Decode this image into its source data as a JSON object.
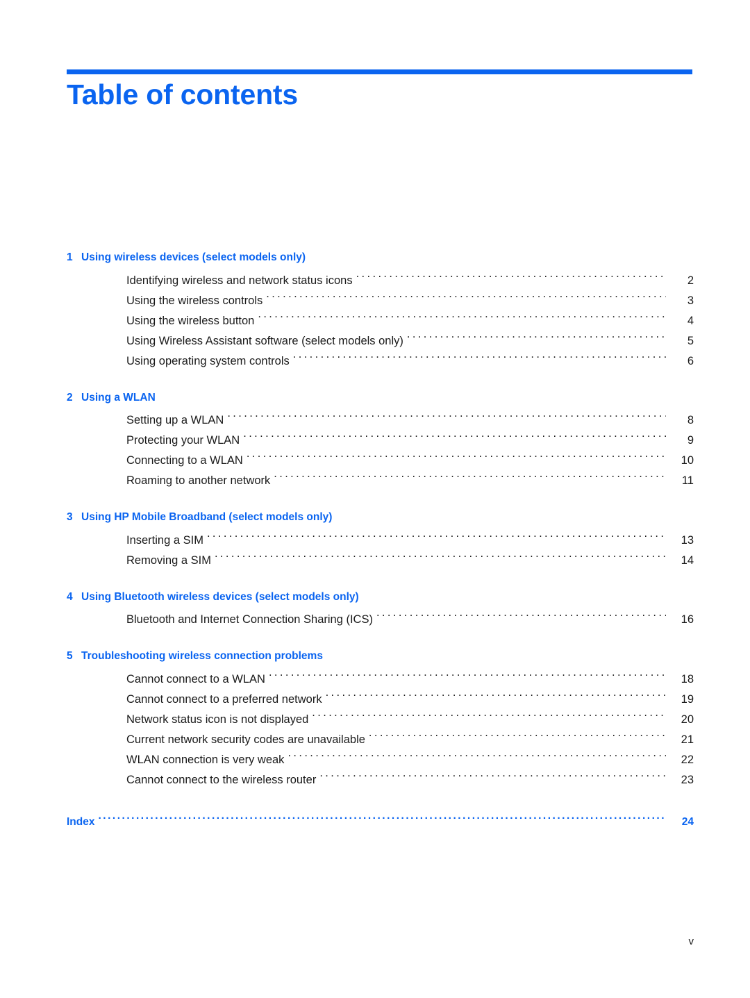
{
  "document": {
    "title": "Table of contents",
    "accent_color": "#0a64f0",
    "text_color": "#1a1a1a",
    "footer_page_number": "v"
  },
  "chapters": [
    {
      "number": "1",
      "title": "Using wireless devices (select models only)",
      "entries": [
        {
          "label": "Identifying wireless and network status icons",
          "page": "2"
        },
        {
          "label": "Using the wireless controls",
          "page": "3"
        },
        {
          "label": "Using the wireless button",
          "page": "4"
        },
        {
          "label": "Using Wireless Assistant software (select models only)",
          "page": "5"
        },
        {
          "label": "Using operating system controls",
          "page": "6"
        }
      ]
    },
    {
      "number": "2",
      "title": "Using a WLAN",
      "entries": [
        {
          "label": "Setting up a WLAN",
          "page": "8"
        },
        {
          "label": "Protecting your WLAN",
          "page": "9"
        },
        {
          "label": "Connecting to a WLAN",
          "page": "10"
        },
        {
          "label": "Roaming to another network",
          "page": "11"
        }
      ]
    },
    {
      "number": "3",
      "title": "Using HP Mobile Broadband (select models only)",
      "entries": [
        {
          "label": "Inserting a SIM",
          "page": "13"
        },
        {
          "label": "Removing a SIM",
          "page": "14"
        }
      ]
    },
    {
      "number": "4",
      "title": "Using Bluetooth wireless devices (select models only)",
      "entries": [
        {
          "label": "Bluetooth and Internet Connection Sharing (ICS)",
          "page": "16"
        }
      ]
    },
    {
      "number": "5",
      "title": "Troubleshooting wireless connection problems",
      "entries": [
        {
          "label": "Cannot connect to a WLAN",
          "page": "18"
        },
        {
          "label": "Cannot connect to a preferred network",
          "page": "19"
        },
        {
          "label": "Network status icon is not displayed",
          "page": "20"
        },
        {
          "label": "Current network security codes are unavailable",
          "page": "21"
        },
        {
          "label": "WLAN connection is very weak",
          "page": "22"
        },
        {
          "label": "Cannot connect to the wireless router",
          "page": "23"
        }
      ]
    }
  ],
  "index": {
    "label": "Index",
    "page": "24"
  }
}
